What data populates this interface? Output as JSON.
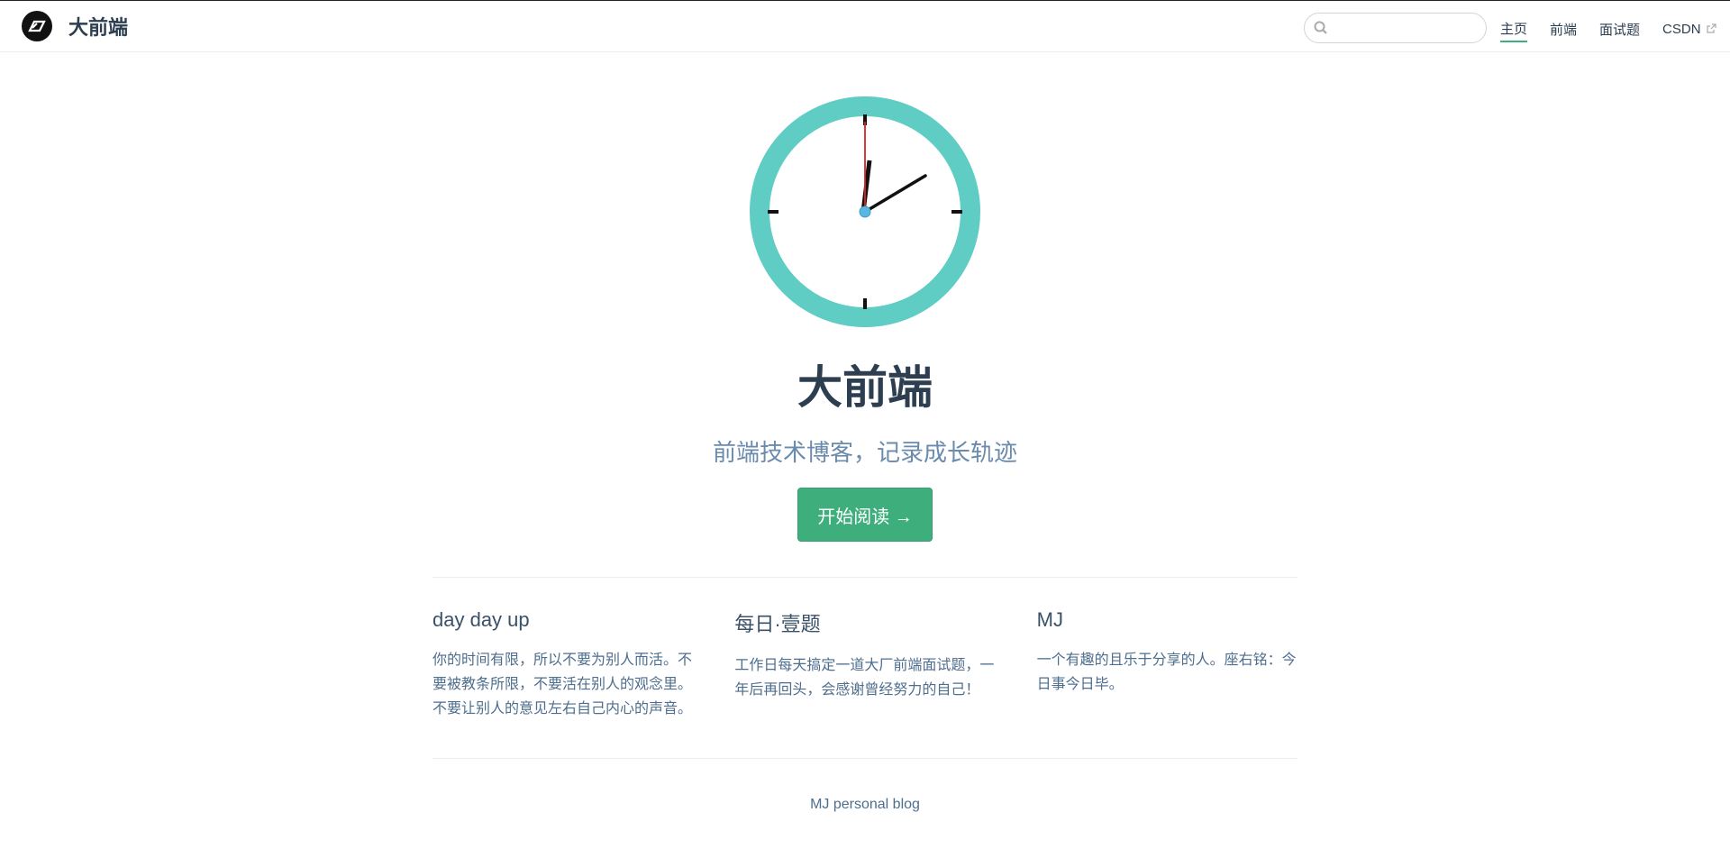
{
  "navbar": {
    "site_name": "大前端",
    "search": {
      "value": "",
      "placeholder": ""
    },
    "links": [
      {
        "label": "主页",
        "active": true
      },
      {
        "label": "前端",
        "active": false
      },
      {
        "label": "面试题",
        "active": false
      },
      {
        "label": "CSDN",
        "active": false,
        "external": true
      }
    ]
  },
  "hero": {
    "clock_time": "1:59:59",
    "title": "大前端",
    "description": "前端技术博客，记录成长轨迹",
    "action_label": "开始阅读 →"
  },
  "features": [
    {
      "title": "day day up",
      "details": "你的时间有限，所以不要为别人而活。不要被教条所限，不要活在别人的观念里。不要让别人的意见左右自己内心的声音。"
    },
    {
      "title": "每日·壹题",
      "details": "工作日每天搞定一道大厂前端面试题，一年后再回头，会感谢曾经努力的自己！"
    },
    {
      "title": "MJ",
      "details": "一个有趣的且乐于分享的人。座右铭：今日事今日毕。"
    }
  ],
  "footer": {
    "text": "MJ personal blog"
  },
  "colors": {
    "accent": "#3eaf7c",
    "clock_ring": "#5fcdc4",
    "text": "#2c3e50",
    "muted": "#6a8bad"
  }
}
